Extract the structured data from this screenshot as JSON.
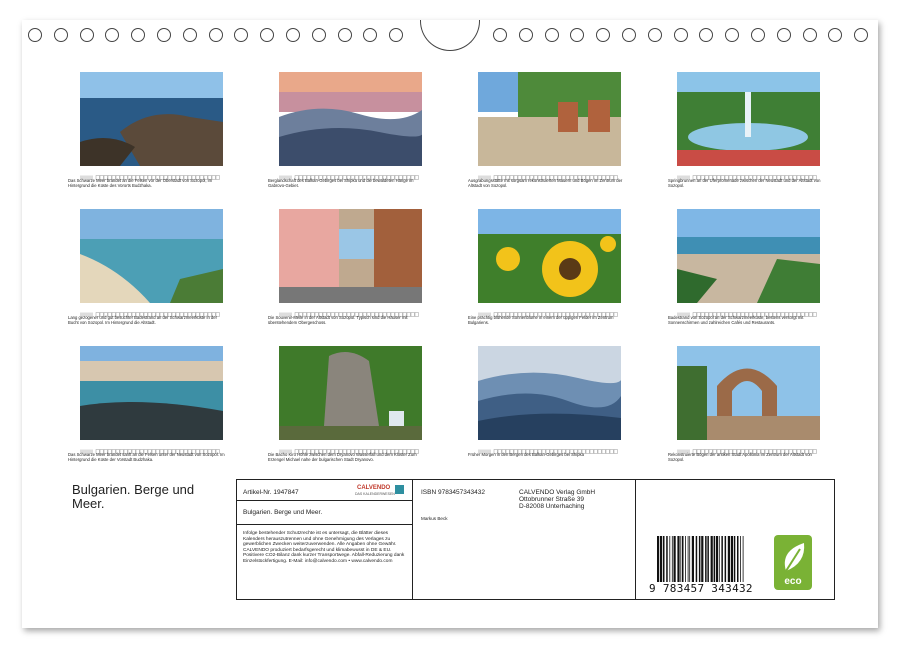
{
  "calendar_title": "Bulgarien. Berge und Meer.",
  "captions": [
    "Das Schwarze Meer brandet an die Felsen vor der Oberstadt von Sozopol, im Hintergrund die Küste des Vororts Budzhaka.",
    "Berglandschaft des Balkan-Gebirges bei Shipka und die bewaldeten Hänge im Gabrovo-Gebiet.",
    "Ausgrabungsstätte mit sorgsam rekonstruierten Mauern und Bögen im Zentrum der Altstadt von Sozopol.",
    "Springbrunnen an der Uferpromenade zwischen der Neustadt und der Altstadt von Sozopol.",
    "Lang gezogener und gut besuchter Badestrand an der Schwarzmeerküste in der Bucht von Sozopol. Im Hintergrund die Altstadt.",
    "Die Souvenir-Meile in der Altstadt von Sozopol. Typisch sind die Häuser mit überstehendem Obergeschoss.",
    "Eine prächtig blühende Sonnenblume in einem der üppigen Felder im Zentrum Bulgariens.",
    "Badestrand von Sozopol an der Schwarzmeerküste, bestens versorgt mit Sonnenschirmen und zahlreichen Cafés und Restaurants.",
    "Das Schwarze Meer brandet sanft an die Felsen unter der Neustadt von Sozopol. Im Hintergrund die Küste der Vorstadt Budzhaka.",
    "Die Bacho Kiro Höhle zwischen dem Dryanovo Wasserfall und dem Kloster Zum Erzengel Michael nahe der bulgarischen Stadt Dryanovo.",
    "Früher Morgen in den Bergen des Balkan-Gebirges bei Shipka",
    "Rekonstruierte Bögen der antiken Stadt Apollonia im Zentrum der Altstadt von Sozopol."
  ],
  "info": {
    "article": "Artikel-Nr. 1947847",
    "brand_logo": "CALVENDO",
    "brand_sub": "DAS KALENDERWESEN",
    "title": "Bulgarien. Berge und Meer.",
    "legal": "Infolge bestehender Schutzrechte ist es untersagt, die Blätter dieses Kalenders herauszutrennen und ohne Genehmigung des Verlages zu gewerblichen Zwecken weiterzuverwenden. Alle Angaben ohne Gewähr. CALVENDO produziert bedarfsgerecht und klimabewusst in DE & EU. Positivere CO2-Bilanz dank kurzer Transportwege. Abfall-Reduzierung dank Einzelstückfertigung. E-Mail: info@calvendo.com • www.calvendo.com",
    "isbn": "ISBN 9783457343432",
    "author": "Markus Beck",
    "publisher_lines": [
      "CALVENDO Verlag GmbH",
      "Ottobrunner Straße 39",
      "D-82008 Unterhaching"
    ],
    "barcode_number": "9 783457 343432",
    "eco_label": "eco"
  },
  "colors": {
    "eco_green": "#7ab235",
    "brand_red": "#c0392b"
  }
}
